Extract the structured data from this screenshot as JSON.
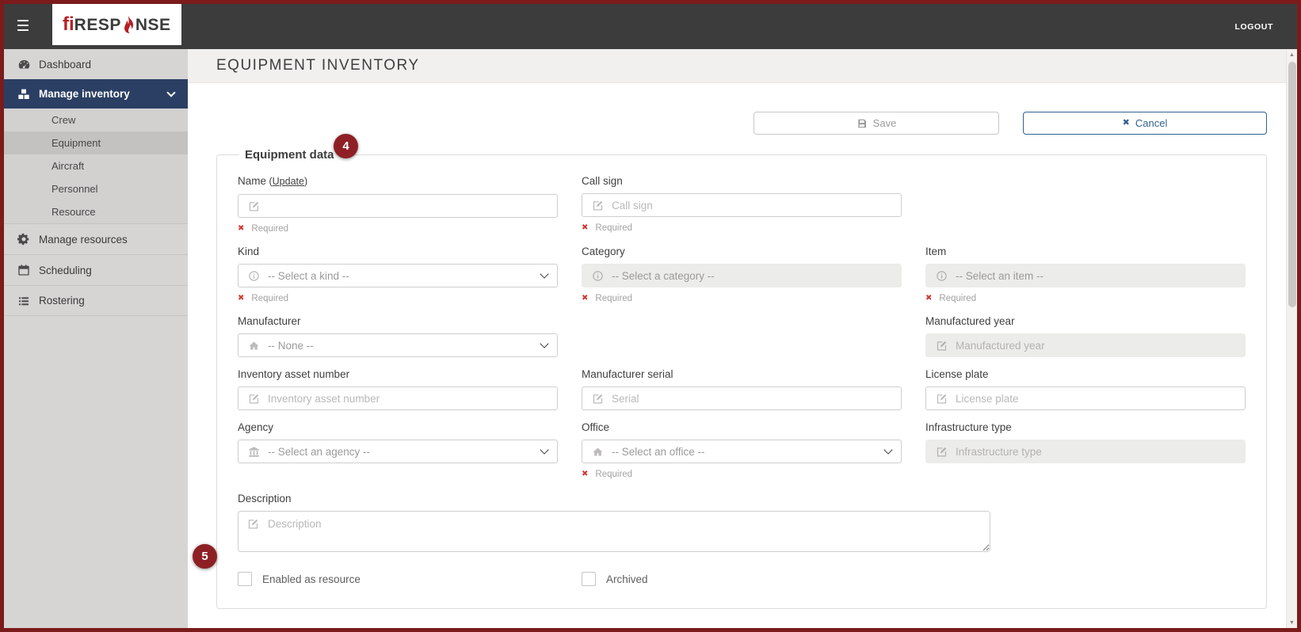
{
  "colors": {
    "frame_border": "#7c1b1b",
    "topbar_bg": "#3d3c3c",
    "sidebar_bg": "#d6d5d4",
    "sidebar_selected_bg": "#2a3f63",
    "sub_selected_bg": "#c3c2c1",
    "header_bg": "#f1f0ef",
    "brand_red": "#b61f24",
    "annotation_red": "#8e2025",
    "cancel_blue": "#31618f",
    "required_red": "#d23b35"
  },
  "topbar": {
    "logo": {
      "part1": "fi",
      "part2": "RESP",
      "part3": "NSE"
    },
    "logout_label": "LOGOUT"
  },
  "sidebar": {
    "dashboard": "Dashboard",
    "manage_inventory": "Manage inventory",
    "crew": "Crew",
    "equipment": "Equipment",
    "aircraft": "Aircraft",
    "personnel": "Personnel",
    "resource": "Resource",
    "manage_resources": "Manage resources",
    "scheduling": "Scheduling",
    "rostering": "Rostering"
  },
  "header": {
    "title": "EQUIPMENT INVENTORY"
  },
  "actions": {
    "save_label": "Save",
    "cancel_label": "Cancel"
  },
  "form": {
    "legend": "Equipment data",
    "required_label": "Required",
    "fields": {
      "name": {
        "label": "Name",
        "open_paren": " (",
        "update_link": "Update",
        "close_paren": ")",
        "placeholder": ""
      },
      "call_sign": {
        "label": "Call sign",
        "placeholder": "Call sign"
      },
      "kind": {
        "label": "Kind",
        "value": "-- Select a kind --"
      },
      "category": {
        "label": "Category",
        "value": "-- Select a category --"
      },
      "item": {
        "label": "Item",
        "value": "-- Select an item --"
      },
      "manufacturer": {
        "label": "Manufacturer",
        "value": "-- None --"
      },
      "manufactured_year": {
        "label": "Manufactured year",
        "placeholder": "Manufactured year"
      },
      "inventory_asset_number": {
        "label": "Inventory asset number",
        "placeholder": "Inventory asset number"
      },
      "manufacturer_serial": {
        "label": "Manufacturer serial",
        "placeholder": "Serial"
      },
      "license_plate": {
        "label": "License plate",
        "placeholder": "License plate"
      },
      "agency": {
        "label": "Agency",
        "value": "-- Select an agency --"
      },
      "office": {
        "label": "Office",
        "value": "-- Select an office --"
      },
      "infrastructure_type": {
        "label": "Infrastructure type",
        "placeholder": "Infrastructure type"
      },
      "description": {
        "label": "Description",
        "placeholder": "Description"
      },
      "enabled_as_resource": {
        "label": "Enabled as resource",
        "checked": false
      },
      "archived": {
        "label": "Archived",
        "checked": false
      }
    }
  },
  "annotations": {
    "badge_4": "4",
    "badge_5": "5"
  },
  "icons": {
    "hamburger": "☰",
    "cancel_x": "✖",
    "required_x": "✖",
    "scroll_up": "▲",
    "scroll_down": "▼",
    "edit": "svg-pencil-square",
    "info": "svg-info-circle",
    "home": "svg-home",
    "bank": "svg-bank",
    "chevron_down": "css-chevron"
  }
}
